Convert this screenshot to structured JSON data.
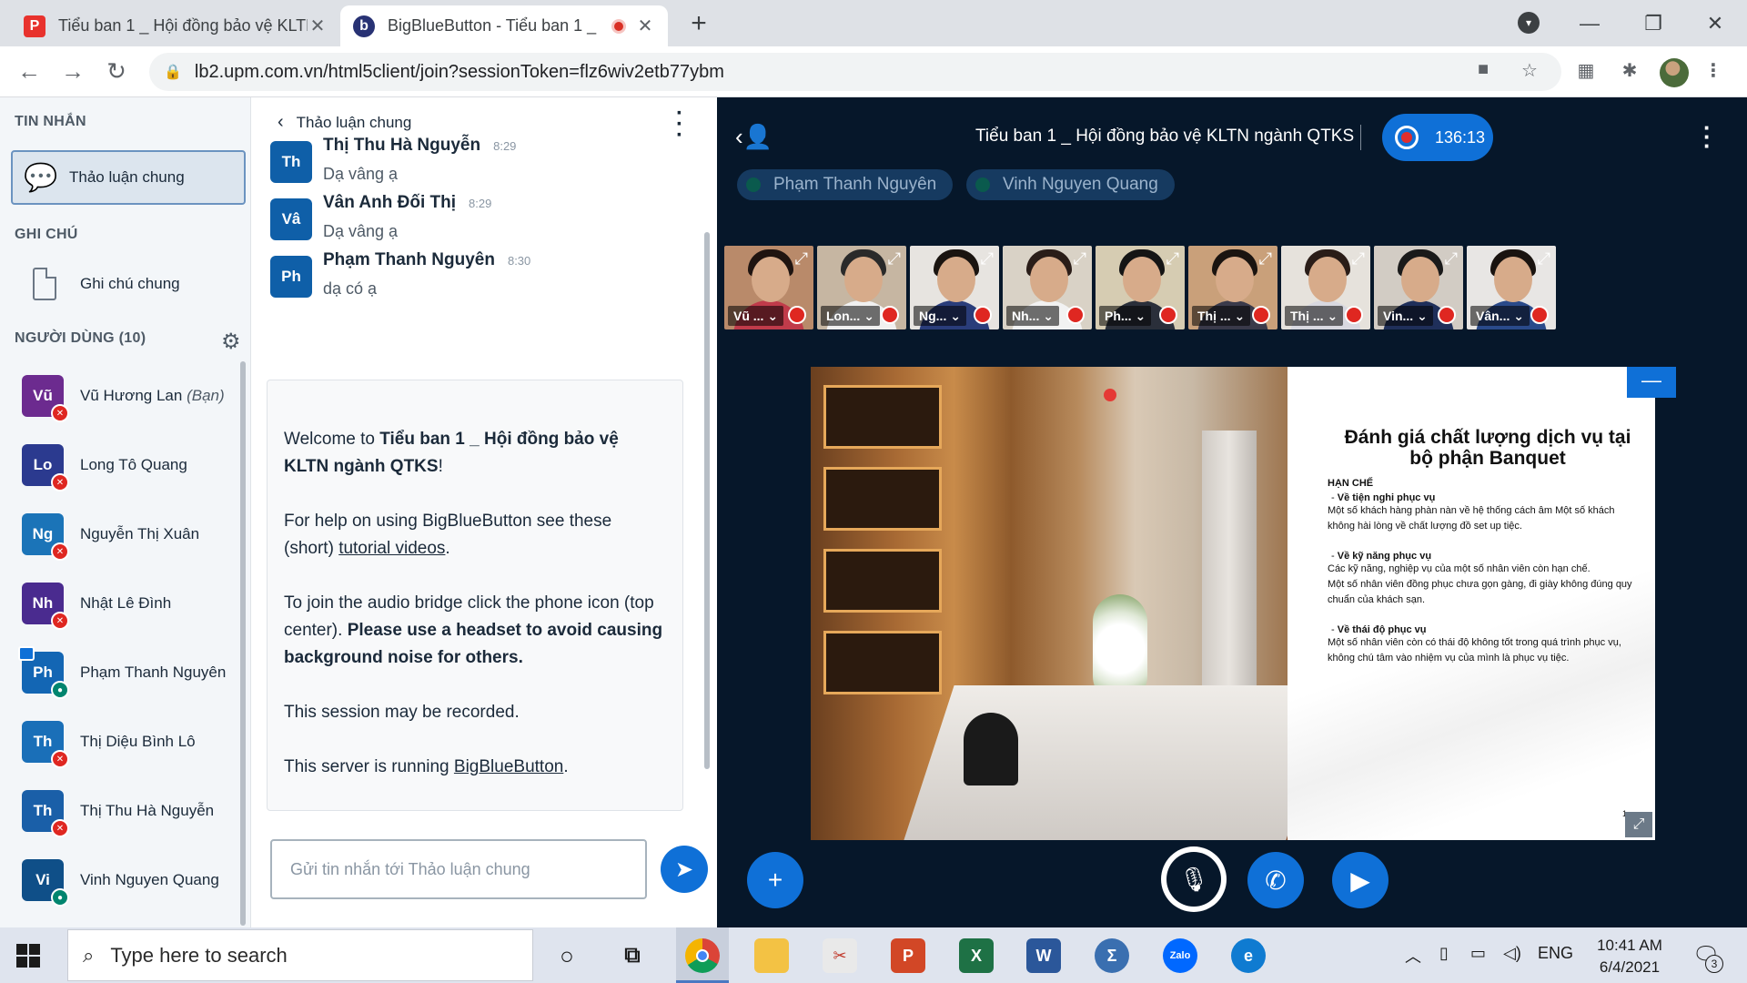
{
  "browser": {
    "tabs": [
      {
        "title": "Tiểu ban 1 _ Hội đồng bảo vệ KLTN"
      },
      {
        "title": "BigBlueButton - Tiểu ban 1 _"
      }
    ],
    "url": "lb2.upm.com.vn/html5client/join?sessionToken=flz6wiv2etb77ybm"
  },
  "left_panel": {
    "messages_title": "TIN NHẮN",
    "public_chat": "Thảo luận chung",
    "notes_title": "GHI CHÚ",
    "shared_notes": "Ghi chú chung",
    "users_title": "NGƯỜI DÙNG (10)",
    "users": [
      {
        "initials": "Vũ",
        "name": "Vũ Hương Lan",
        "you": "(Bạn)",
        "color": "#6c2b8f",
        "status": "muted"
      },
      {
        "initials": "Lo",
        "name": "Long Tô Quang",
        "color": "#2b3a8f",
        "status": "muted"
      },
      {
        "initials": "Ng",
        "name": "Nguyễn Thị Xuân",
        "color": "#1b74b8",
        "status": "muted"
      },
      {
        "initials": "Nh",
        "name": "Nhật Lê Đình",
        "color": "#4a2b8f",
        "status": "muted"
      },
      {
        "initials": "Ph",
        "name": "Phạm Thanh Nguyên",
        "color": "#1366b4",
        "status": "talk",
        "presenter": true
      },
      {
        "initials": "Th",
        "name": "Thị Diệu Bình Lô",
        "color": "#1a6fb8",
        "status": "muted"
      },
      {
        "initials": "Th",
        "name": "Thị Thu Hà Nguyễn",
        "color": "#1a5fa8",
        "status": "muted"
      },
      {
        "initials": "Vi",
        "name": "Vinh Nguyen Quang",
        "color": "#0f4f88",
        "status": "talk"
      }
    ]
  },
  "chat": {
    "header": "Thảo luận chung",
    "messages": [
      {
        "initials": "Th",
        "name": "Thị Thu Hà Nguyễn",
        "time": "8:29",
        "text": "Dạ vâng ạ"
      },
      {
        "initials": "Vâ",
        "name": "Vân Anh Đối Thị",
        "time": "8:29",
        "text": "Dạ vâng ạ"
      },
      {
        "initials": "Ph",
        "name": "Phạm Thanh Nguyên",
        "time": "8:30",
        "text": "dạ có ạ"
      }
    ],
    "welcome": {
      "p1_pre": "Welcome to ",
      "p1_bold": "Tiểu ban 1 _ Hội đồng bảo vệ KLTN ngành QTKS",
      "p1_post": "!",
      "p2_pre": "For help on using BigBlueButton see these (short) ",
      "p2_link": "tutorial videos",
      "p2_post": ".",
      "p3_pre": "To join the audio bridge click the phone icon (top center). ",
      "p3_bold": "Please use a headset to avoid causing background noise for others.",
      "p4": "This session may be recorded.",
      "p5_pre": "This server is running ",
      "p5_link": "BigBlueButton",
      "p5_post": "."
    },
    "input_placeholder": "Gửi tin nhắn tới Thảo luận chung"
  },
  "meeting": {
    "title": "Tiểu ban 1 _ Hội đồng bảo vệ KLTN ngành QTKS",
    "recording_time": "136:13",
    "talkers": [
      "Phạm Thanh Nguyên",
      "Vinh Nguyen Quang"
    ],
    "videos": [
      {
        "label": "Vũ ...",
        "bg": "#b98a6a",
        "shirt": "#c03b4a",
        "hair": "#1f1410"
      },
      {
        "label": "Lon...",
        "bg": "#c6b6a2",
        "shirt": "#f0f0f0",
        "hair": "#2a2a2a"
      },
      {
        "label": "Ng...",
        "bg": "#e7e4e0",
        "shirt": "#2a3d7a",
        "hair": "#1a1410"
      },
      {
        "label": "Nh...",
        "bg": "#d9d2c6",
        "shirt": "#f2f2f2",
        "hair": "#2a1d18"
      },
      {
        "label": "Ph...",
        "bg": "#d6ccb2",
        "shirt": "#2a2f3a",
        "hair": "#151515"
      },
      {
        "label": "Thị ...",
        "bg": "#c9a07a",
        "shirt": "#3a3a4a",
        "hair": "#1a1410"
      },
      {
        "label": "Thị ...",
        "bg": "#e6e2dc",
        "shirt": "#d8d8e0",
        "hair": "#2a1d18"
      },
      {
        "label": "Vin...",
        "bg": "#d2ccc4",
        "shirt": "#1f2f5a",
        "hair": "#1a1a1a"
      },
      {
        "label": "Vân...",
        "bg": "#e8e6e4",
        "shirt": "#2a4a8a",
        "hair": "#1a1410"
      }
    ],
    "slide": {
      "title": "Đánh giá chất lượng dịch vụ  tại bộ phận Banquet",
      "heading": "HẠN CHẾ",
      "s1": "Về tiện nghi phục vụ",
      "s1_text": "Một số khách hàng phàn nàn về hệ thống cách âm  Một số khách không hài lòng về chất lượng đồ set  up tiệc.",
      "s2": "Về kỹ năng phục vụ",
      "s2_text1": "Các kỹ năng, nghiệp vụ của một số nhân viên còn  hạn chế.",
      "s2_text2": "Một số nhân viên đồng phục chưa gọn gàng, đi giày  không đúng quy chuẩn của khách sạn.",
      "s3": "Về thái độ phục vụ",
      "s3_text": "Một số nhân viên còn có thái độ không tốt trong quá trình phục vụ, không chú tâm vào nhiệm vụ của  mình là phục vụ tiệc.",
      "page_marker": "1"
    }
  },
  "taskbar": {
    "search_placeholder": "Type here to search",
    "lang": "ENG",
    "time": "10:41 AM",
    "date": "6/4/2021",
    "notif_count": "3"
  }
}
